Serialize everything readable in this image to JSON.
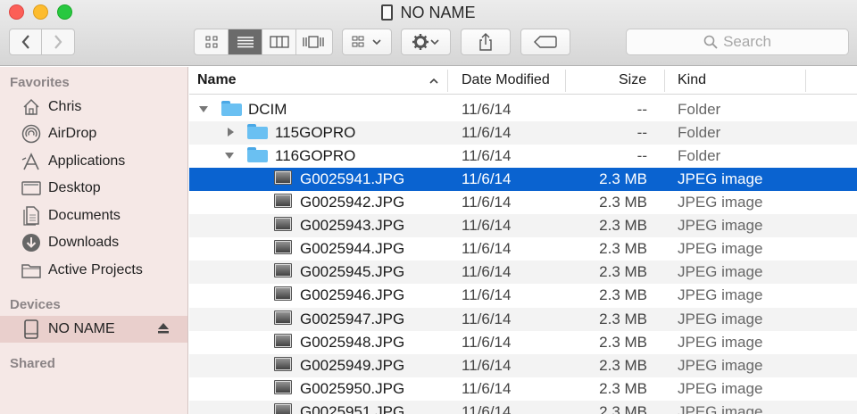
{
  "window": {
    "title": "NO NAME"
  },
  "toolbar": {
    "search_placeholder": "Search"
  },
  "sidebar": {
    "favorites_heading": "Favorites",
    "favorites": [
      {
        "label": "Chris",
        "icon": "home-icon"
      },
      {
        "label": "AirDrop",
        "icon": "airdrop-icon"
      },
      {
        "label": "Applications",
        "icon": "applications-icon"
      },
      {
        "label": "Desktop",
        "icon": "desktop-icon"
      },
      {
        "label": "Documents",
        "icon": "documents-icon"
      },
      {
        "label": "Downloads",
        "icon": "downloads-icon"
      },
      {
        "label": "Active Projects",
        "icon": "folder-icon"
      }
    ],
    "devices_heading": "Devices",
    "devices": [
      {
        "label": "NO NAME",
        "icon": "drive-icon",
        "selected": true
      }
    ],
    "shared_heading": "Shared"
  },
  "columns": {
    "name": "Name",
    "date": "Date Modified",
    "size": "Size",
    "kind": "Kind"
  },
  "files": [
    {
      "name": "DCIM",
      "date": "11/6/14",
      "size": "--",
      "kind": "Folder"
    },
    {
      "name": "115GOPRO",
      "date": "11/6/14",
      "size": "--",
      "kind": "Folder"
    },
    {
      "name": "116GOPRO",
      "date": "11/6/14",
      "size": "--",
      "kind": "Folder"
    },
    {
      "name": "G0025941.JPG",
      "date": "11/6/14",
      "size": "2.3 MB",
      "kind": "JPEG image",
      "selected": true
    },
    {
      "name": "G0025942.JPG",
      "date": "11/6/14",
      "size": "2.3 MB",
      "kind": "JPEG image"
    },
    {
      "name": "G0025943.JPG",
      "date": "11/6/14",
      "size": "2.3 MB",
      "kind": "JPEG image"
    },
    {
      "name": "G0025944.JPG",
      "date": "11/6/14",
      "size": "2.3 MB",
      "kind": "JPEG image"
    },
    {
      "name": "G0025945.JPG",
      "date": "11/6/14",
      "size": "2.3 MB",
      "kind": "JPEG image"
    },
    {
      "name": "G0025946.JPG",
      "date": "11/6/14",
      "size": "2.3 MB",
      "kind": "JPEG image"
    },
    {
      "name": "G0025947.JPG",
      "date": "11/6/14",
      "size": "2.3 MB",
      "kind": "JPEG image"
    },
    {
      "name": "G0025948.JPG",
      "date": "11/6/14",
      "size": "2.3 MB",
      "kind": "JPEG image"
    },
    {
      "name": "G0025949.JPG",
      "date": "11/6/14",
      "size": "2.3 MB",
      "kind": "JPEG image"
    },
    {
      "name": "G0025950.JPG",
      "date": "11/6/14",
      "size": "2.3 MB",
      "kind": "JPEG image"
    },
    {
      "name": "G0025951.JPG",
      "date": "11/6/14",
      "size": "2.3 MB",
      "kind": "JPEG image"
    }
  ],
  "colors": {
    "selection": "#0a63d0",
    "sidebar_bg": "#f5e8e6",
    "folder": "#6ac0f2"
  }
}
